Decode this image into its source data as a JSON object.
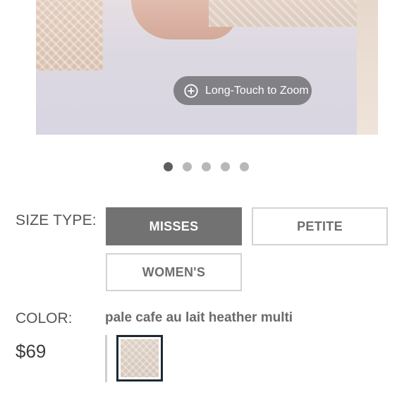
{
  "gallery": {
    "zoom_hint": "Long-Touch to Zoom",
    "zoom_icon": "plus-circle-icon",
    "dots_total": 5,
    "active_dot": 1
  },
  "size_type": {
    "label": "SIZE TYPE:",
    "options": [
      {
        "label": "MISSES",
        "selected": true
      },
      {
        "label": "PETITE",
        "selected": false
      },
      {
        "label": "WOMEN'S",
        "selected": false
      }
    ]
  },
  "color": {
    "label": "COLOR:",
    "selected_name": "pale cafe au lait heather multi"
  },
  "price": "$69",
  "colors": {
    "selected_button_bg": "#727272",
    "unselected_border": "#d3d3d3",
    "swatch_border": "#1e2a33"
  }
}
